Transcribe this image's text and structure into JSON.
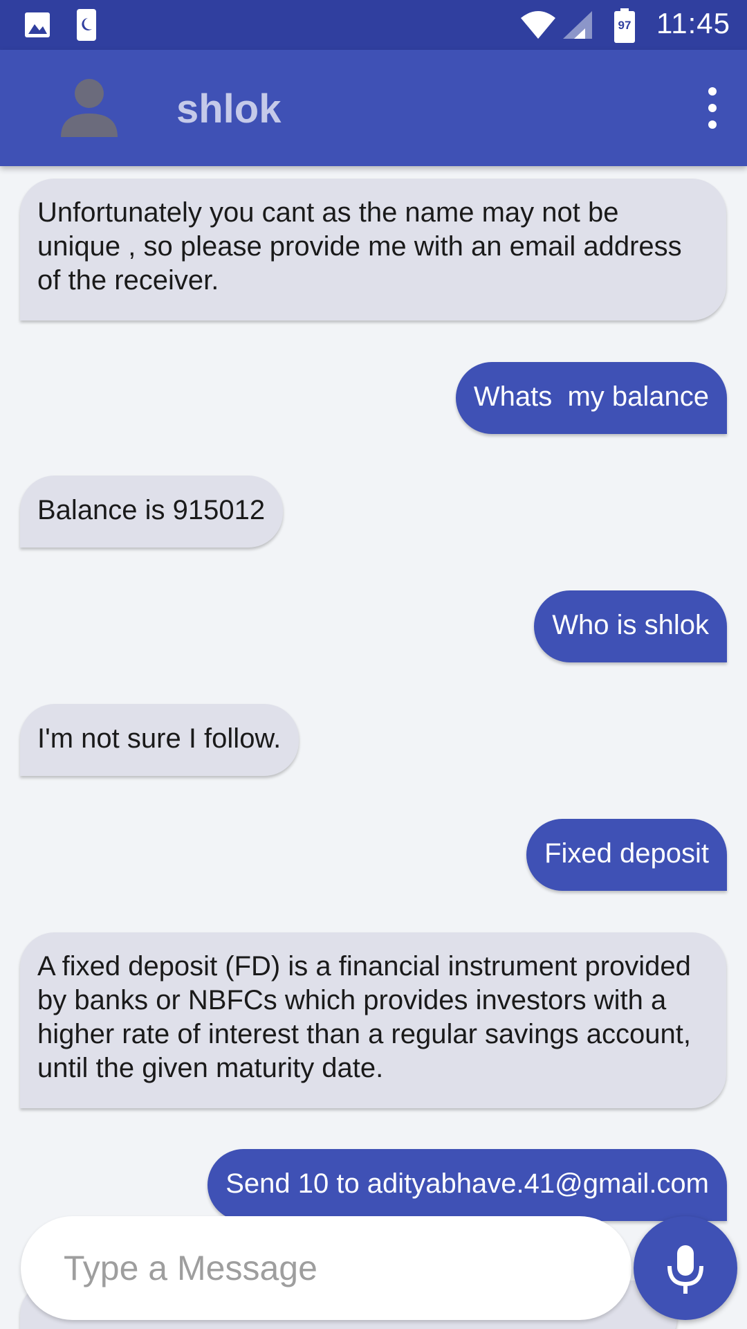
{
  "status_bar": {
    "time": "11:45",
    "battery_level": "97",
    "icons": [
      "image-icon",
      "moon-icon",
      "wifi-icon",
      "signal-icon",
      "battery-icon"
    ]
  },
  "app_bar": {
    "title": "shlok",
    "icons": [
      "avatar-icon",
      "more-vert-icon"
    ]
  },
  "messages": [
    {
      "sender": "bot",
      "text": "Unfortunately you cant as the name may not be unique , so please provide me with an email address of the receiver."
    },
    {
      "sender": "user",
      "text": "Whats  my balance"
    },
    {
      "sender": "bot",
      "text": "Balance is 915012"
    },
    {
      "sender": "user",
      "text": "Who is shlok"
    },
    {
      "sender": "bot",
      "text": "I'm not sure I follow."
    },
    {
      "sender": "user",
      "text": "Fixed deposit"
    },
    {
      "sender": "bot",
      "text": "A fixed deposit (FD) is a financial instrument provided by banks or NBFCs which provides investors with a higher rate of interest than a regular savings account, until the given maturity date."
    },
    {
      "sender": "user",
      "text": "Send 10 to adityabhave.41@gmail.com"
    }
  ],
  "composer": {
    "placeholder": "Type a Message",
    "value": "",
    "mic_icon": "mic-icon"
  },
  "colors": {
    "primary": "#3f51b5",
    "primary_dark": "#303f9f",
    "bot_bubble": "#dfe0ea",
    "background": "#f2f4f7"
  }
}
